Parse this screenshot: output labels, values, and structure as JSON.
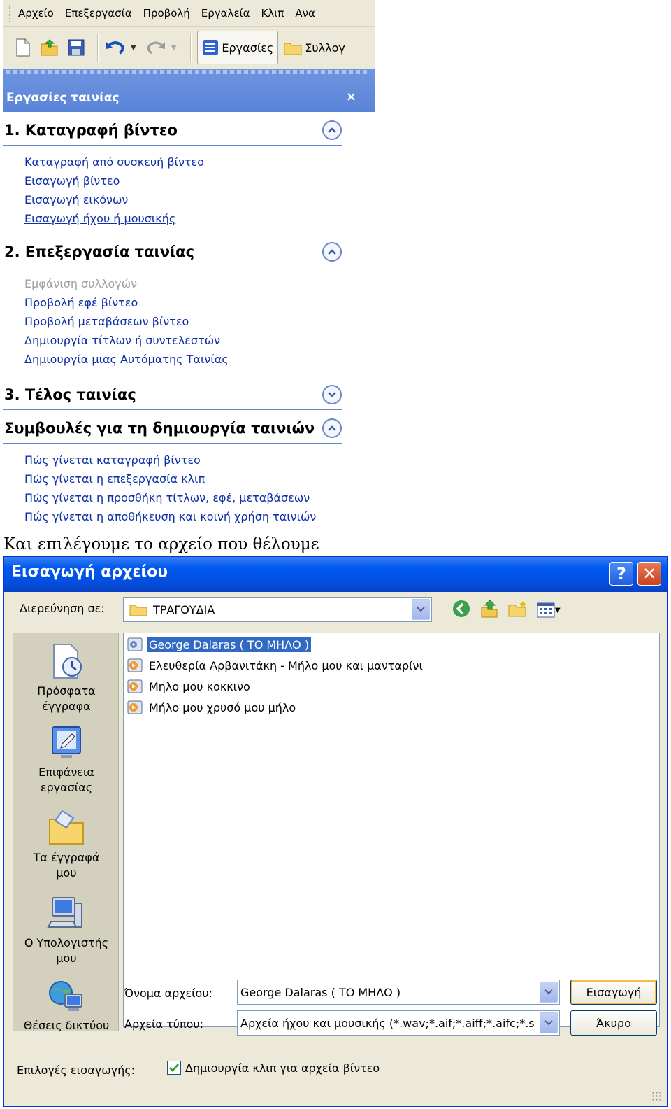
{
  "menubar": {
    "items": [
      "Αρχείο",
      "Επεξεργασία",
      "Προβολή",
      "Εργαλεία",
      "Κλιπ",
      "Ανα"
    ]
  },
  "toolbar": {
    "tasks_label": "Εργασίες",
    "collections_label": "Συλλογ"
  },
  "task_pane": {
    "title": "Εργασίες ταινίας",
    "close_glyph": "×",
    "sections": [
      {
        "title": "1. Καταγραφή βίντεο",
        "expanded": true,
        "links": [
          "Καταγραφή από συσκευή βίντεο",
          "Εισαγωγή βίντεο",
          "Εισαγωγή εικόνων",
          "Εισαγωγή ήχου ή μουσικής"
        ]
      },
      {
        "title": "2. Επεξεργασία ταινίας",
        "expanded": true,
        "links": [
          "Εμφάνιση συλλογών",
          "Προβολή εφέ βίντεο",
          "Προβολή μεταβάσεων βίντεο",
          "Δημιουργία τίτλων ή συντελεστών",
          "Δημιουργία μιας Αυτόματης Ταινίας"
        ]
      },
      {
        "title": "3. Τέλος ταινίας",
        "expanded": false,
        "links": []
      },
      {
        "title": "Συμβουλές για τη δημιουργία ταινιών",
        "expanded": true,
        "links": [
          "Πώς γίνεται καταγραφή βίντεο",
          "Πώς γίνεται η επεξεργασία κλιπ",
          "Πώς γίνεται η προσθήκη τίτλων, εφέ, μεταβάσεων",
          "Πώς γίνεται η αποθήκευση και κοινή χρήση ταινιών"
        ]
      }
    ]
  },
  "caption": "Και επιλέγουμε το αρχείο που θέλουμε",
  "dialog": {
    "title": "Εισαγωγή αρχείου",
    "help_glyph": "?",
    "close_glyph": "✕",
    "look_in_label": "Διερεύνηση σε:",
    "look_in_value": "ΤΡΑΓΟΥΔΙΑ",
    "places": [
      "Πρόσφατα έγγραφα",
      "Επιφάνεια εργασίας",
      "Τα έγγραφά μου",
      "Ο Υπολογιστής μου",
      "Θέσεις δικτύου"
    ],
    "files": [
      "George Dalaras ( ΤΟ ΜΗΛΟ )",
      "Ελευθερία Αρβανιτάκη - Μήλο μου και μανταρίνι",
      "Μηλο μου κοκκινο",
      "Μήλο μου χρυσό μου μήλο"
    ],
    "selected_file": "George Dalaras ( ΤΟ ΜΗΛΟ )",
    "filename_label": "Όνομα αρχείου:",
    "filename_value": "George Dalaras ( ΤΟ ΜΗΛΟ )",
    "filetype_label": "Αρχεία τύπου:",
    "filetype_value": "Αρχεία ήχου και μουσικής (*.wav;*.aif;*.aiff;*.aifc;*.s",
    "import_button": "Εισαγωγή",
    "cancel_button": "Άκυρο",
    "options_label": "Επιλογές εισαγωγής:",
    "checkbox_label": "Δημιουργία κλιπ για αρχεία βίντεο",
    "checkbox_checked": true
  },
  "colors": {
    "link": "#0d2fa8",
    "task_header": "#5a84d8",
    "dialog_titlebar": "#0058ee",
    "selection": "#316ac5"
  }
}
